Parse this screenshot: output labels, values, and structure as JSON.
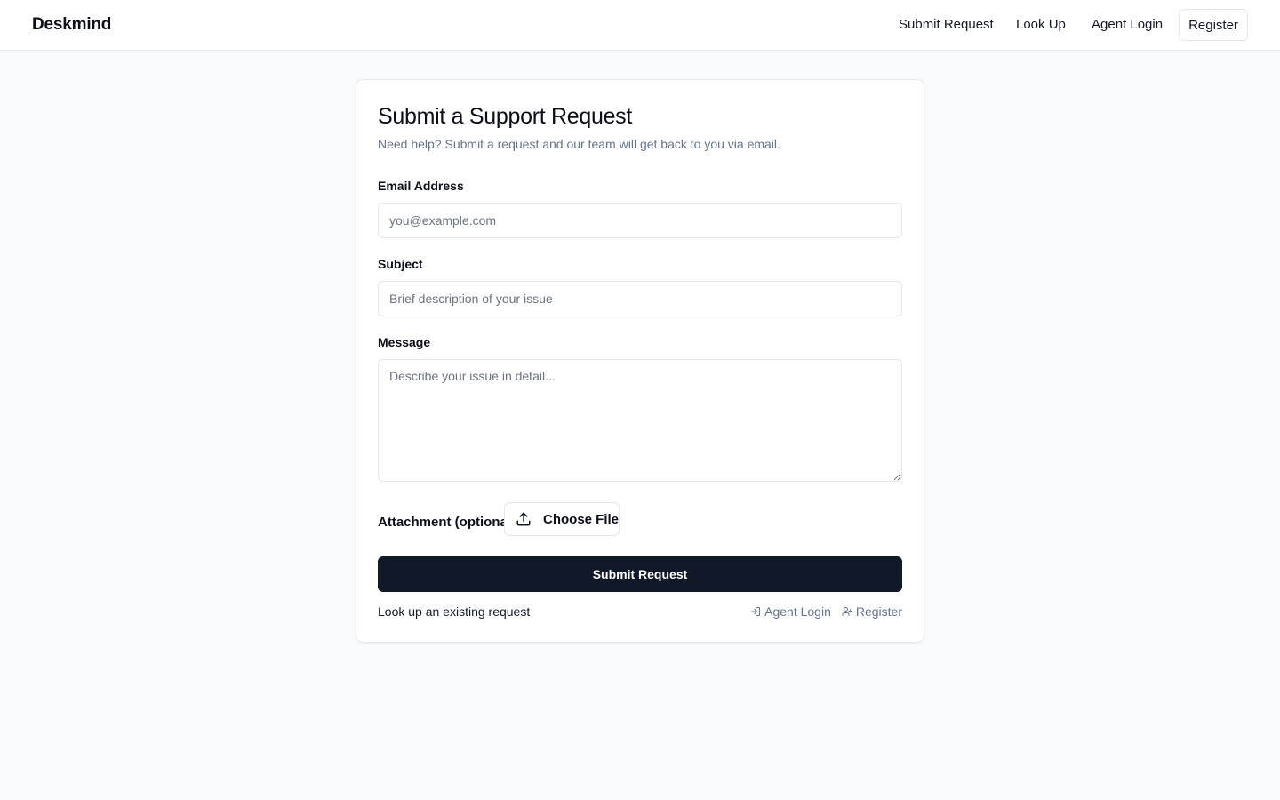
{
  "header": {
    "brand": "Deskmind",
    "nav": {
      "submit_request": "Submit Request",
      "look_up": "Look Up",
      "agent_login": "Agent Login",
      "register": "Register"
    }
  },
  "form": {
    "title": "Submit a Support Request",
    "subtitle": "Need help? Submit a request and our team will get back to you via email.",
    "email": {
      "label": "Email Address",
      "placeholder": "you@example.com",
      "value": ""
    },
    "subject": {
      "label": "Subject",
      "placeholder": "Brief description of your issue",
      "value": ""
    },
    "message": {
      "label": "Message",
      "placeholder": "Describe your issue in detail...",
      "value": ""
    },
    "attachment": {
      "label": "Attachment (optional)",
      "button_label": "Choose File",
      "icon": "upload-icon"
    },
    "submit_label": "Submit Request",
    "footer": {
      "lookup_link": "Look up an existing request",
      "agent_login": "Agent Login",
      "agent_login_icon": "log-in-icon",
      "register": "Register",
      "register_icon": "user-plus-icon"
    }
  },
  "colors": {
    "page_background": "#f9fafb",
    "primary_button": "#111827",
    "muted_text": "#64748b",
    "border": "#e5e7eb"
  }
}
